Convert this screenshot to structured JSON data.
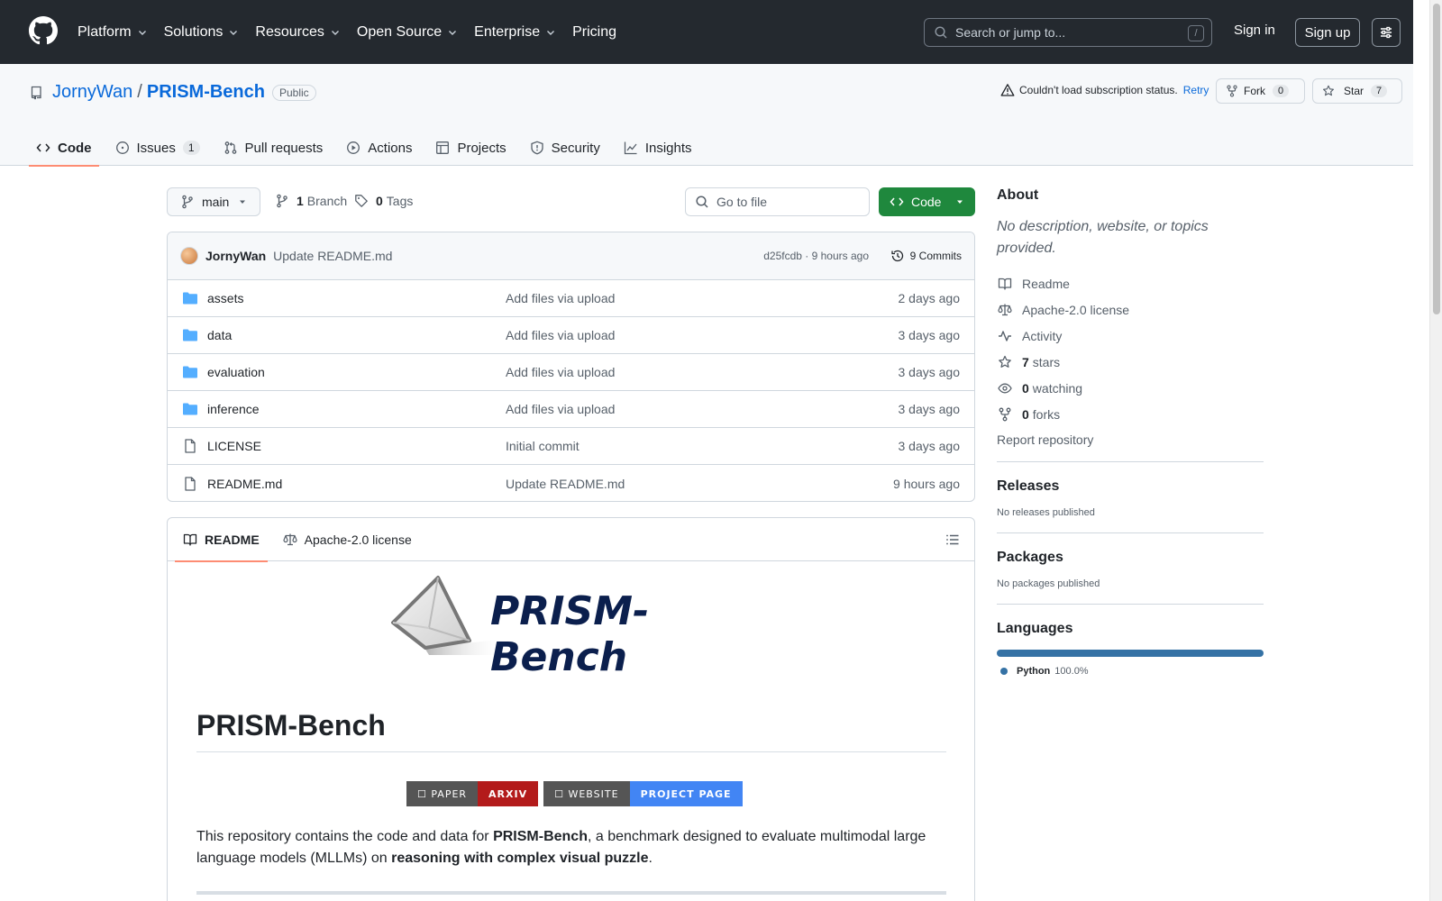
{
  "header": {
    "nav": [
      {
        "label": "Platform"
      },
      {
        "label": "Solutions"
      },
      {
        "label": "Resources"
      },
      {
        "label": "Open Source"
      },
      {
        "label": "Enterprise"
      },
      {
        "label": "Pricing"
      }
    ],
    "search_placeholder": "Search or jump to...",
    "search_key": "/",
    "sign_in": "Sign in",
    "sign_up": "Sign up"
  },
  "repo": {
    "owner": "JornyWan",
    "separator": "/",
    "name": "PRISM-Bench",
    "visibility": "Public",
    "subscription_status": "Couldn't load subscription status.",
    "retry": "Retry",
    "fork_label": "Fork",
    "fork_count": "0",
    "star_label": "Star",
    "star_count": "7",
    "tabs": [
      {
        "label": "Code",
        "active": true
      },
      {
        "label": "Issues",
        "count": "1"
      },
      {
        "label": "Pull requests"
      },
      {
        "label": "Actions"
      },
      {
        "label": "Projects"
      },
      {
        "label": "Security"
      },
      {
        "label": "Insights"
      }
    ]
  },
  "toolbar": {
    "branch": "main",
    "branch_count": "1",
    "branch_label": "Branch",
    "tag_count": "0",
    "tag_label": "Tags",
    "goto_placeholder": "Go to file",
    "code_button": "Code"
  },
  "latest_commit": {
    "author": "JornyWan",
    "message": "Update README.md",
    "meta": "d25fcdb · 9 hours ago",
    "commits": "9 Commits"
  },
  "files": [
    {
      "type": "folder",
      "name": "assets",
      "message": "Add files via upload",
      "date": "2 days ago"
    },
    {
      "type": "folder",
      "name": "data",
      "message": "Add files via upload",
      "date": "3 days ago"
    },
    {
      "type": "folder",
      "name": "evaluation",
      "message": "Add files via upload",
      "date": "3 days ago"
    },
    {
      "type": "folder",
      "name": "inference",
      "message": "Add files via upload",
      "date": "3 days ago"
    },
    {
      "type": "file",
      "name": "LICENSE",
      "message": "Initial commit",
      "date": "3 days ago"
    },
    {
      "type": "file",
      "name": "README.md",
      "message": "Update README.md",
      "date": "9 hours ago"
    }
  ],
  "readme": {
    "tab_readme": "README",
    "tab_license": "Apache-2.0 license",
    "logo_text": "PRISM-Bench",
    "heading": "PRISM-Bench",
    "badges": {
      "paper_left": "☐ PAPER",
      "paper_right": "ARXIV",
      "site_left": "☐ WEBSITE",
      "site_right": "PROJECT PAGE"
    },
    "para": {
      "p1": "This repository contains the code and data for ",
      "b1": "PRISM-Bench",
      "p2": ", a benchmark designed to evaluate multimodal large language models (MLLMs) on ",
      "b2": "reasoning with complex visual puzzle",
      "p3": "."
    }
  },
  "sidebar": {
    "about_title": "About",
    "about_desc": "No description, website, or topics provided.",
    "readme": "Readme",
    "license": "Apache-2.0 license",
    "activity": "Activity",
    "stars_count": "7",
    "stars_label": "stars",
    "watching_count": "0",
    "watching_label": "watching",
    "forks_count": "0",
    "forks_label": "forks",
    "report": "Report repository",
    "releases_title": "Releases",
    "releases_text": "No releases published",
    "packages_title": "Packages",
    "packages_text": "No packages published",
    "languages_title": "Languages",
    "language": {
      "name": "Python",
      "percent": "100.0%",
      "fraction": 1.0,
      "color": "#3572a5"
    }
  },
  "colors": {
    "header_bg": "#24292f",
    "link": "#0969da",
    "code_button": "#1f883d",
    "tab_underline": "#fd8c73"
  }
}
